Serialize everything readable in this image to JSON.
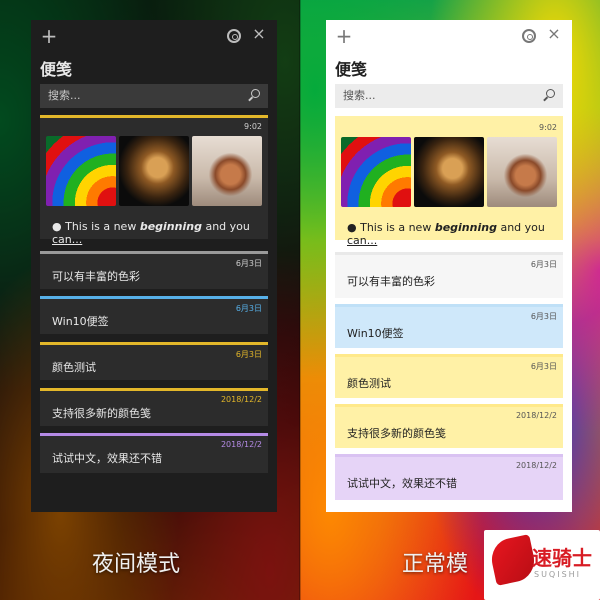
{
  "left_panel": {
    "title": "便笺",
    "search_placeholder": "搜索...",
    "notes": [
      {
        "time": "9:02",
        "text_prefix": "● This is a new ",
        "text_bold": "beginning",
        "text_mid": " and you",
        "text_underline": " can...",
        "has_images": true,
        "accent": "#E3B72A"
      },
      {
        "time": "6月3日",
        "text": "可以有丰富的色彩",
        "accent": "#9A9A9A"
      },
      {
        "time": "6月3日",
        "text": "Win10便签",
        "accent": "#57B0E8"
      },
      {
        "time": "6月3日",
        "text": "颜色测试",
        "accent": "#E3B72A"
      },
      {
        "time": "2018/12/2",
        "text": "支持很多新的颜色笺",
        "accent": "#E3B72A"
      },
      {
        "time": "2018/12/2",
        "text": "试试中文，效果还不错",
        "accent": "#B58BE6"
      }
    ]
  },
  "right_panel": {
    "title": "便笺",
    "search_placeholder": "搜索...",
    "notes": [
      {
        "time": "9:02",
        "text_prefix": "● This is a new ",
        "text_bold": "beginning",
        "text_mid": " and you",
        "text_underline": " can...",
        "has_images": true,
        "bg": "#FFF1A6"
      },
      {
        "time": "6月3日",
        "text": "可以有丰富的色彩",
        "bg": "#F6F6F6"
      },
      {
        "time": "6月3日",
        "text": "Win10便签",
        "bg": "#CFE8FA"
      },
      {
        "time": "6月3日",
        "text": "颜色测试",
        "bg": "#FFF1A6"
      },
      {
        "time": "2018/12/2",
        "text": "支持很多新的颜色笺",
        "bg": "#FFF1A6"
      },
      {
        "time": "2018/12/2",
        "text": "试试中文，效果还不错",
        "bg": "#E6D4F7"
      }
    ]
  },
  "captions": {
    "left": "夜间模式",
    "right": "正常模"
  },
  "logo": {
    "text": "速骑士",
    "subtext": "SUQISHI"
  },
  "icons": {
    "add": "plus-icon",
    "settings": "gear-icon",
    "close": "close-icon",
    "search": "search-icon"
  },
  "colors": {
    "dark_bg": "#1E1E1E",
    "light_bg": "#FFFFFF",
    "accent_yellow": "#E3B72A"
  }
}
